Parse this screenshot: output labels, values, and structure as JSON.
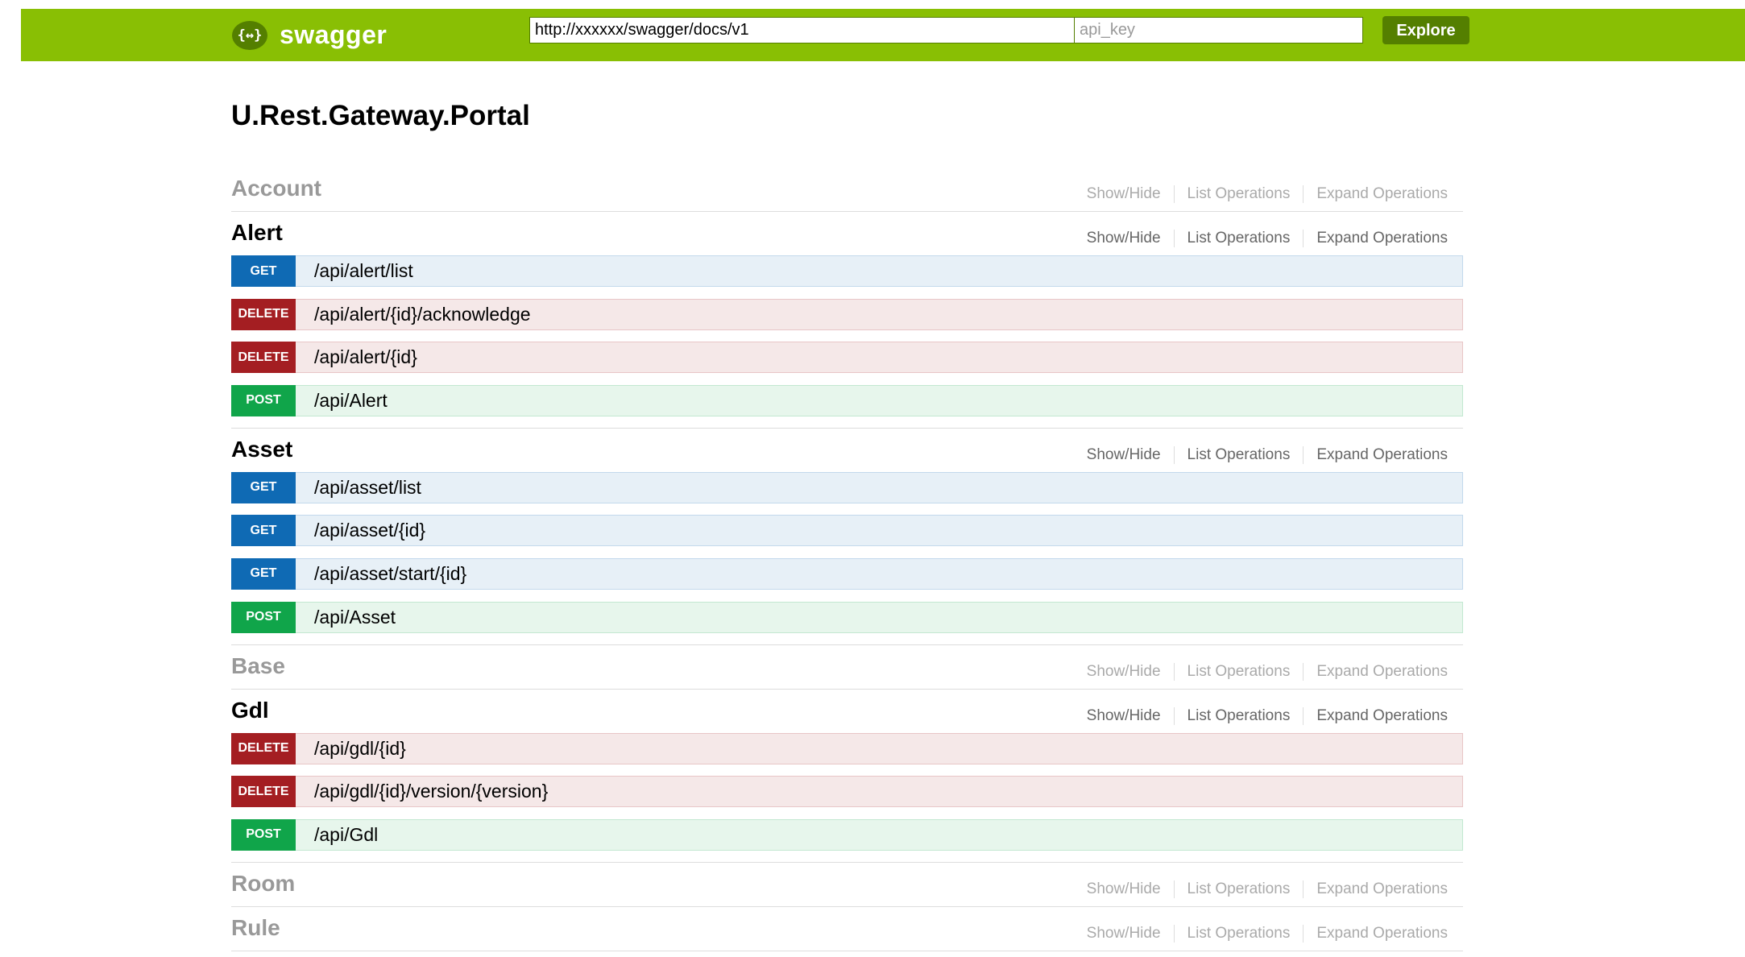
{
  "header": {
    "logo_icon": "{↔}",
    "logo_text": "swagger",
    "url_value": "http://xxxxxx/swagger/docs/v1",
    "api_key_placeholder": "api_key",
    "explore_label": "Explore",
    "brand_color": "#89bf04"
  },
  "title": "U.Rest.Gateway.Portal",
  "links": {
    "show_hide": "Show/Hide",
    "list_ops": "List Operations",
    "expand_ops": "Expand Operations"
  },
  "method_colors": {
    "GET": "#0f6ab4",
    "DELETE": "#a41e22",
    "POST": "#10a54a"
  },
  "resources": [
    {
      "name": "Account",
      "expanded": false,
      "operations": []
    },
    {
      "name": "Alert",
      "expanded": true,
      "operations": [
        {
          "method": "GET",
          "path": "/api/alert/list"
        },
        {
          "method": "DELETE",
          "path": "/api/alert/{id}/acknowledge"
        },
        {
          "method": "DELETE",
          "path": "/api/alert/{id}"
        },
        {
          "method": "POST",
          "path": "/api/Alert"
        }
      ]
    },
    {
      "name": "Asset",
      "expanded": true,
      "operations": [
        {
          "method": "GET",
          "path": "/api/asset/list"
        },
        {
          "method": "GET",
          "path": "/api/asset/{id}"
        },
        {
          "method": "GET",
          "path": "/api/asset/start/{id}"
        },
        {
          "method": "POST",
          "path": "/api/Asset"
        }
      ]
    },
    {
      "name": "Base",
      "expanded": false,
      "operations": []
    },
    {
      "name": "Gdl",
      "expanded": true,
      "operations": [
        {
          "method": "DELETE",
          "path": "/api/gdl/{id}"
        },
        {
          "method": "DELETE",
          "path": "/api/gdl/{id}/version/{version}"
        },
        {
          "method": "POST",
          "path": "/api/Gdl"
        }
      ]
    },
    {
      "name": "Room",
      "expanded": false,
      "operations": []
    },
    {
      "name": "Rule",
      "expanded": false,
      "operations": []
    }
  ]
}
